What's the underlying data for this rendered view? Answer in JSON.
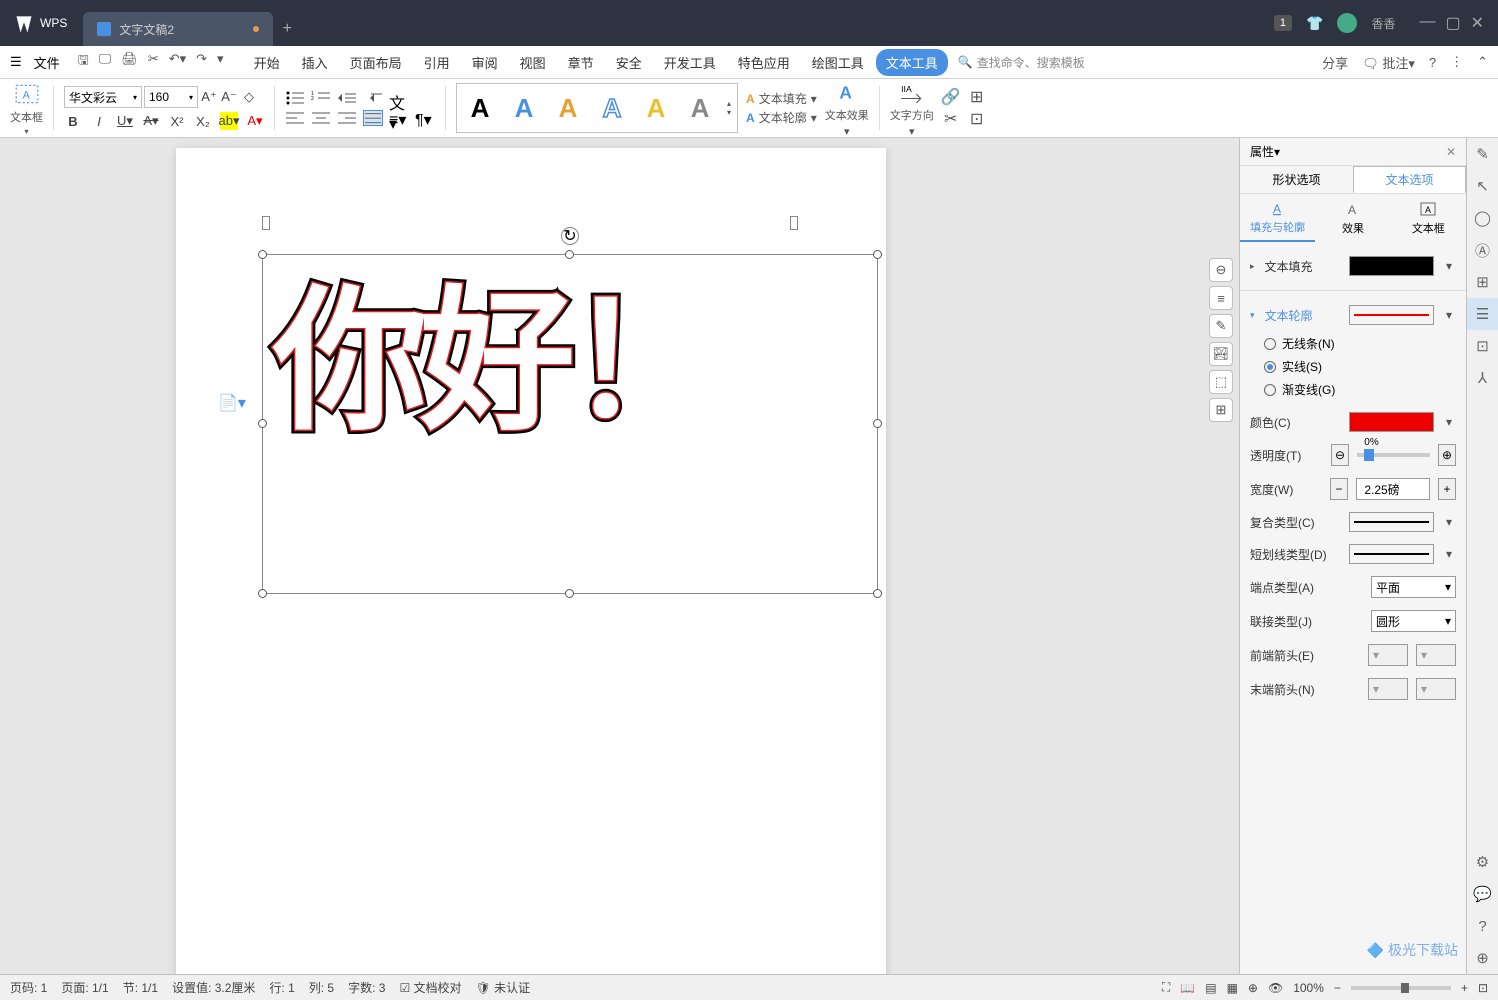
{
  "app": {
    "brand": "WPS",
    "user": "香香"
  },
  "tab": {
    "name": "文字文稿2"
  },
  "menu": {
    "file": "文件",
    "items": [
      "开始",
      "插入",
      "页面布局",
      "引用",
      "审阅",
      "视图",
      "章节",
      "安全",
      "开发工具",
      "特色应用",
      "绘图工具",
      "文本工具"
    ],
    "active": "文本工具",
    "search_ph": "查找命令、搜索模板",
    "share": "分享",
    "annotate": "批注"
  },
  "toolbar": {
    "txtbox": "文本框",
    "font": "华文彩云",
    "fontsize": "160",
    "text_fill": "文本填充",
    "text_outline": "文本轮廓",
    "text_effect": "文本效果",
    "text_dir": "文字方向"
  },
  "canvas": {
    "text": "你好！",
    "chars": [
      "你",
      "好",
      "！"
    ]
  },
  "props": {
    "title": "属性",
    "tabs": [
      "形状选项",
      "文本选项"
    ],
    "tab_active": "文本选项",
    "icons": [
      "填充与轮廓",
      "效果",
      "文本框"
    ],
    "icon_active": "填充与轮廓",
    "fill_section": "文本填充",
    "outline_section": "文本轮廓",
    "line_opts": {
      "none": "无线条(N)",
      "solid": "实线(S)",
      "grad": "渐变线(G)"
    },
    "color_lbl": "颜色(C)",
    "opacity_lbl": "透明度(T)",
    "opacity_val": "0%",
    "width_lbl": "宽度(W)",
    "width_val": "2.25磅",
    "compound_lbl": "复合类型(C)",
    "dash_lbl": "短划线类型(D)",
    "cap_lbl": "端点类型(A)",
    "cap_val": "平面",
    "join_lbl": "联接类型(J)",
    "join_val": "圆形",
    "arrow_s": "前端箭头(E)",
    "arrow_e": "末端箭头(N)"
  },
  "status": {
    "page": "页码: 1",
    "pages": "页面: 1/1",
    "sec": "节: 1/1",
    "set": "设置值: 3.2厘米",
    "ln": "行: 1",
    "col": "列: 5",
    "wc": "字数: 3",
    "proof": "文档校对",
    "auth": "未认证",
    "zoom": "100%"
  },
  "watermark": "极光下载站"
}
